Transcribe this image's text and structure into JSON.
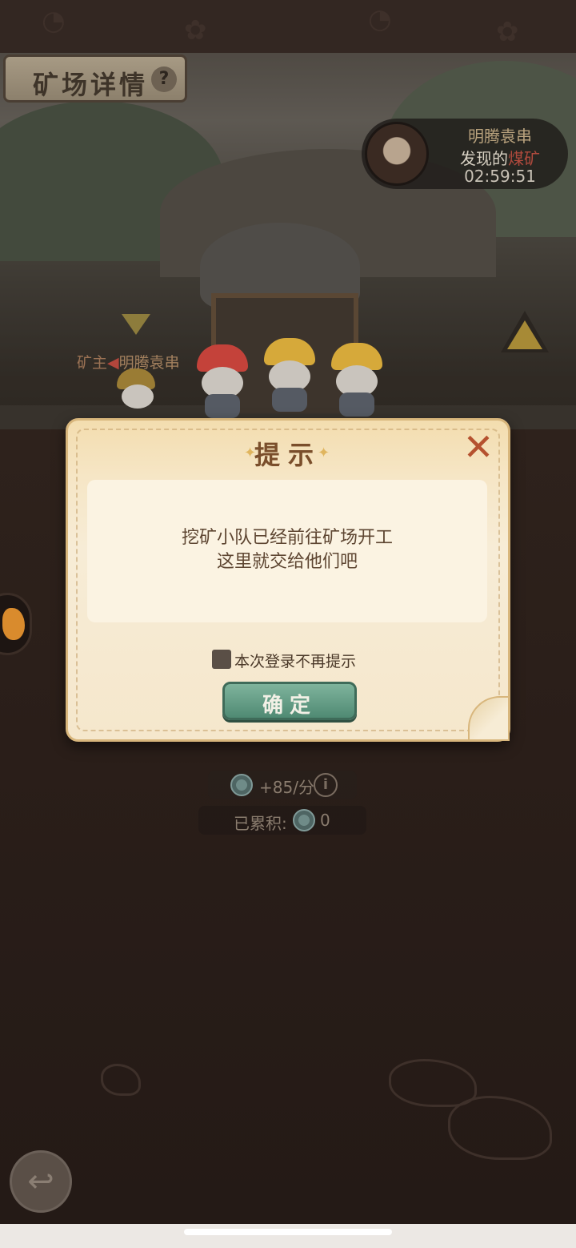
{
  "header": {
    "title": "矿场详情",
    "help_icon": "?"
  },
  "owner_card": {
    "name": "明腾袁串",
    "found_prefix": "发现的",
    "found_mine": "煤矿",
    "timer": "02:59:51"
  },
  "owner_marker": {
    "label": "矿主",
    "name": "明腾袁串"
  },
  "stats": {
    "rate": "+85/分",
    "info_icon": "i",
    "accumulated_label": "已累积:",
    "accumulated_value": "0"
  },
  "dialog": {
    "title": "提示",
    "close_icon": "✕",
    "message_line1": "挖矿小队已经前往矿场开工",
    "message_line2": "这里就交给他们吧",
    "checkbox_label": "本次登录不再提示",
    "checkbox_checked": false,
    "confirm_label": "确定"
  },
  "nav": {
    "back_icon": "↩"
  },
  "colors": {
    "dialog_bg": "#f7ecd6",
    "confirm_green": "#4f8a73",
    "close_red": "#b5512f",
    "title_brown": "#7a4e2b"
  }
}
